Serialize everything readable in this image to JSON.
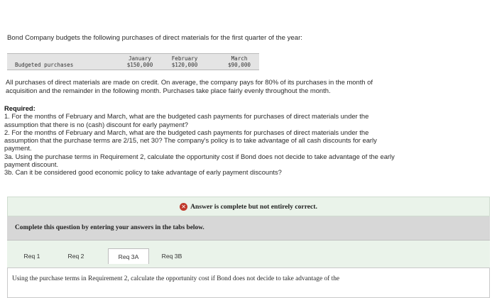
{
  "intro": "Bond Company budgets the following purchases of direct materials for the first quarter of the year:",
  "budget_table": {
    "row_label": "Budgeted purchases",
    "columns": [
      {
        "month": "January",
        "value": "$150,000"
      },
      {
        "month": "February",
        "value": "$120,000"
      },
      {
        "month": "March",
        "value": "$90,000"
      }
    ]
  },
  "paragraph": [
    "All purchases of direct materials are made on credit. On average, the company pays for 80% of its purchases in the month of",
    "acquisition and the remainder in the following month. Purchases take place fairly evenly throughout the month."
  ],
  "required": {
    "heading": "Required:",
    "lines": [
      "1. For the months of February and March, what are the budgeted cash payments for purchases of direct materials under the",
      "assumption that there is no (cash) discount for early payment?",
      "2. For the months of February and March, what are the budgeted cash payments for purchases of direct materials under the",
      "assumption that the purchase terms are 2/15, net 30? The company's policy is to take advantage of all cash discounts for early",
      "payment.",
      "3a. Using the purchase terms in Requirement 2, calculate the opportunity cost if Bond does not decide to take advantage of the early",
      "payment discount.",
      "3b. Can it be considered good economic policy to take advantage of early payment discounts?"
    ]
  },
  "answer_banner": {
    "icon": "x-circle-icon",
    "icon_glyph": "✕",
    "text": "Answer is complete but not entirely correct."
  },
  "instruction": "Complete this question by entering your answers in the tabs below.",
  "tabs": [
    {
      "label": "Req 1",
      "active": false
    },
    {
      "label": "Req 2",
      "active": false
    },
    {
      "label": "Req 3A",
      "active": true
    },
    {
      "label": "Req 3B",
      "active": false
    }
  ],
  "tab_content": "Using the purchase terms in Requirement 2, calculate the opportunity cost if Bond does not decide to take advantage of the",
  "colors": {
    "banner_green": "#eaf3ea",
    "instruction_gray": "#d7d7d7",
    "error_red": "#c0392b"
  }
}
